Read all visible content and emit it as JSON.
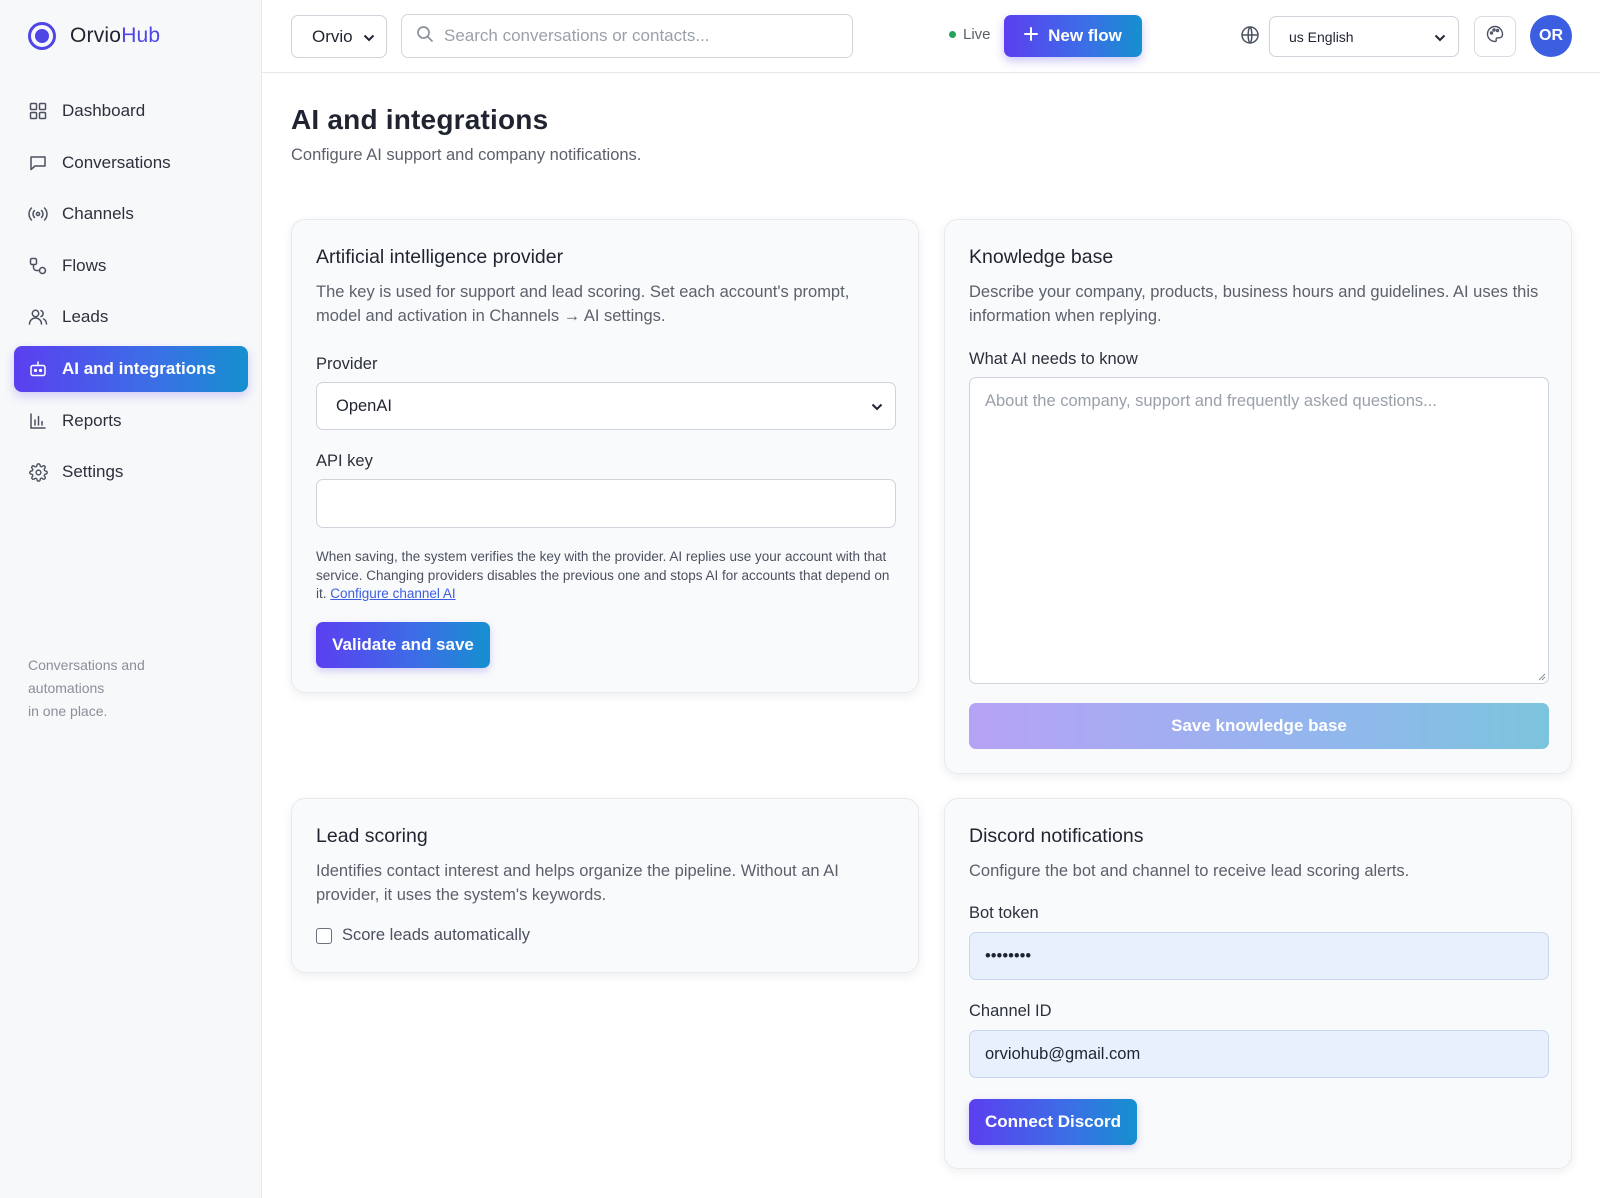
{
  "brand": {
    "name_part1": "Orvio",
    "name_part2": "Hub"
  },
  "sidebar": {
    "items": [
      {
        "label": "Dashboard",
        "icon": "grid-icon"
      },
      {
        "label": "Conversations",
        "icon": "chat-icon"
      },
      {
        "label": "Channels",
        "icon": "broadcast-icon"
      },
      {
        "label": "Flows",
        "icon": "flow-icon"
      },
      {
        "label": "Leads",
        "icon": "users-icon"
      },
      {
        "label": "AI and integrations",
        "icon": "bot-icon",
        "active": true
      },
      {
        "label": "Reports",
        "icon": "bar-chart-icon"
      },
      {
        "label": "Settings",
        "icon": "gear-icon"
      }
    ],
    "tagline_line1": "Conversations and",
    "tagline_line2": "automations",
    "tagline_line3": "in one place."
  },
  "topbar": {
    "org_selected": "Orvio",
    "search_placeholder": "Search conversations or contacts...",
    "status": "Live",
    "new_flow_label": "New flow",
    "language_selected": "us English",
    "avatar_initials": "OR"
  },
  "page": {
    "title": "AI and integrations",
    "subtitle": "Configure AI support and company notifications."
  },
  "ai_provider": {
    "title": "Artificial intelligence provider",
    "description": "The key is used for support and lead scoring. Set each account's prompt, model and activation in Channels → AI settings.",
    "provider_label": "Provider",
    "provider_selected": "OpenAI",
    "api_key_label": "API key",
    "api_key_value": "",
    "note": "When saving, the system verifies the key with the provider. AI replies use your account with that service. Changing providers disables the previous one and stops AI for accounts that depend on it.",
    "note_link": "Configure channel AI",
    "save_label": "Validate and save"
  },
  "knowledge_base": {
    "title": "Knowledge base",
    "description": "Describe your company, products, business hours and guidelines. AI uses this information when replying.",
    "field_label": "What AI needs to know",
    "placeholder": "About the company, support and frequently asked questions...",
    "save_label": "Save knowledge base"
  },
  "lead_scoring": {
    "title": "Lead scoring",
    "description": "Identifies contact interest and helps organize the pipeline. Without an AI provider, it uses the system's keywords.",
    "checkbox_label": "Score leads automatically",
    "checked": false
  },
  "discord": {
    "title": "Discord notifications",
    "description": "Configure the bot and channel to receive lead scoring alerts.",
    "bot_token_label": "Bot token",
    "bot_token_value": "••••••••",
    "channel_id_label": "Channel ID",
    "channel_id_value": "orviohub@gmail.com",
    "connect_label": "Connect Discord"
  },
  "colors": {
    "accent": "#4f46e5",
    "gradient_start": "#5b3ff0",
    "gradient_end": "#1590cf",
    "live_dot": "#22a55b"
  }
}
